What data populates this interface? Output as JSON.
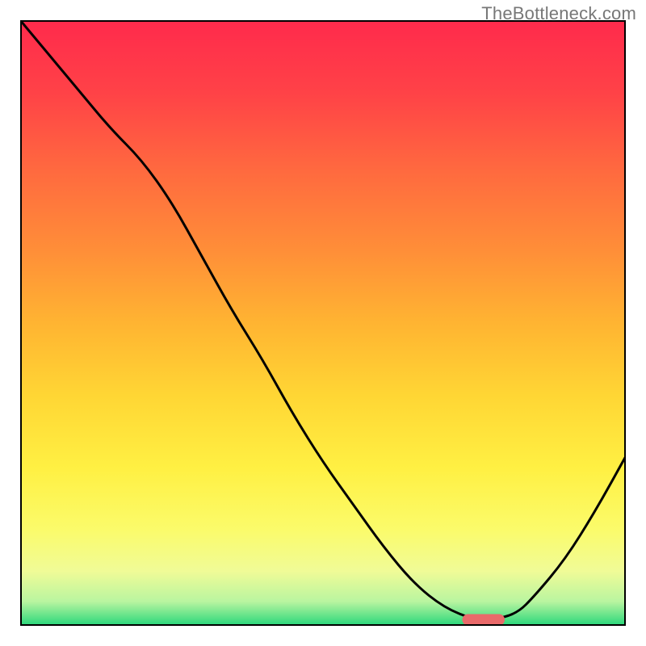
{
  "watermark": "TheBottleneck.com",
  "chart_data": {
    "type": "line",
    "title": "",
    "xlabel": "",
    "ylabel": "",
    "xlim": [
      0,
      100
    ],
    "ylim": [
      0,
      100
    ],
    "grid": false,
    "legend": false,
    "series": [
      {
        "name": "curve",
        "x": [
          0,
          5,
          10,
          15,
          20,
          25,
          30,
          35,
          40,
          45,
          50,
          55,
          60,
          65,
          70,
          75,
          78,
          82,
          85,
          90,
          95,
          100
        ],
        "y": [
          100,
          94,
          88,
          82,
          77,
          70,
          61,
          52,
          44,
          35,
          27,
          20,
          13,
          7,
          3,
          1,
          1,
          2,
          5,
          11,
          19,
          28
        ]
      }
    ],
    "highlight": {
      "name": "optimal",
      "x_start": 73,
      "x_end": 80,
      "y": 1
    },
    "gradient_stops": [
      {
        "offset": 0.0,
        "color": "#ff2a4c"
      },
      {
        "offset": 0.12,
        "color": "#ff4247"
      },
      {
        "offset": 0.25,
        "color": "#ff6a3f"
      },
      {
        "offset": 0.38,
        "color": "#ff8e38"
      },
      {
        "offset": 0.5,
        "color": "#ffb432"
      },
      {
        "offset": 0.62,
        "color": "#ffd634"
      },
      {
        "offset": 0.74,
        "color": "#fff043"
      },
      {
        "offset": 0.84,
        "color": "#fbfb6a"
      },
      {
        "offset": 0.91,
        "color": "#f0fb97"
      },
      {
        "offset": 0.96,
        "color": "#b9f5a0"
      },
      {
        "offset": 1.0,
        "color": "#27d67a"
      }
    ]
  }
}
